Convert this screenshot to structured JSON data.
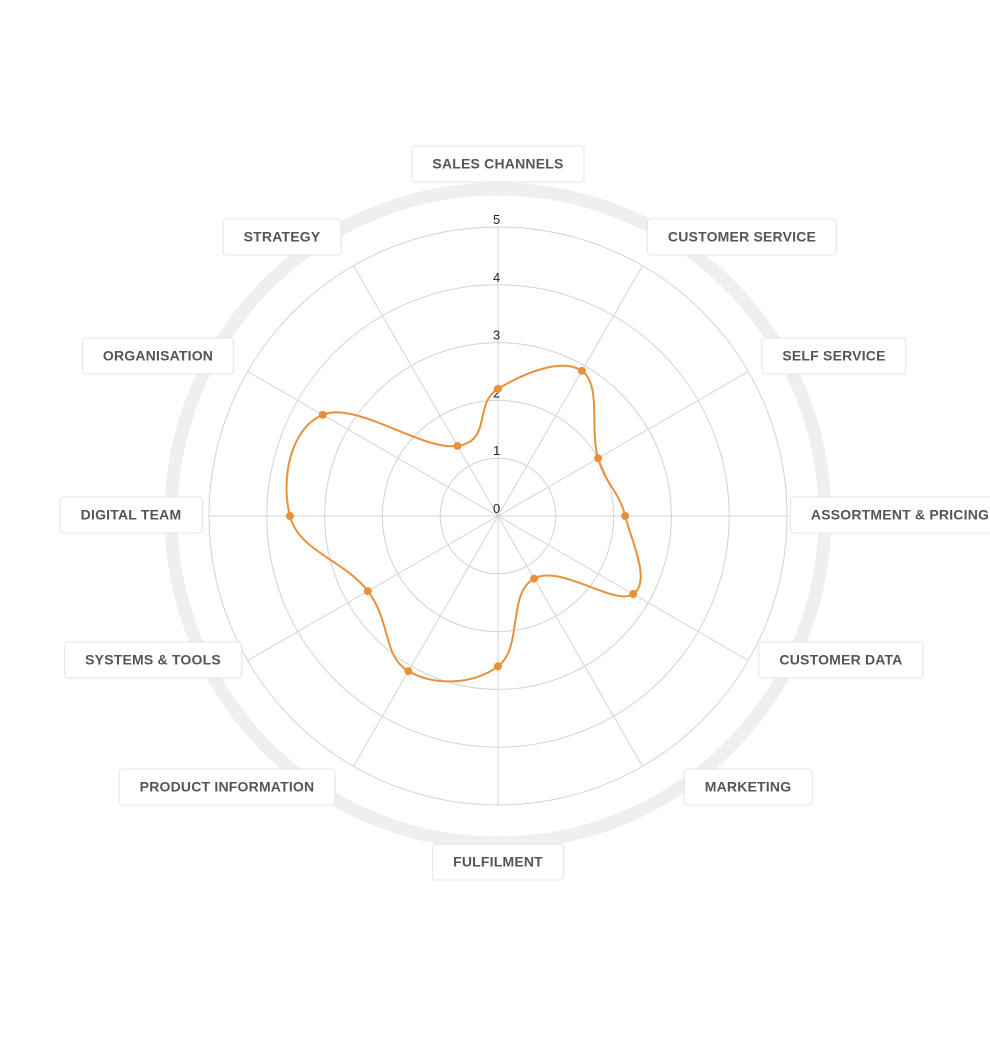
{
  "chart_data": {
    "type": "radar",
    "categories": [
      "SALES CHANNELS",
      "CUSTOMER SERVICE",
      "SELF SERVICE",
      "ASSORTMENT & PRICING",
      "CUSTOMER DATA",
      "MARKETING",
      "FULFILMENT",
      "PRODUCT INFORMATION",
      "SYSTEMS & TOOLS",
      "DIGITAL TEAM",
      "ORGANISATION",
      "STRATEGY"
    ],
    "values": [
      2.2,
      2.9,
      2.0,
      2.2,
      2.7,
      1.25,
      2.6,
      3.1,
      2.6,
      3.6,
      3.5,
      1.4
    ],
    "rlim": [
      0,
      5
    ],
    "ticks": [
      "0",
      "1",
      "2",
      "3",
      "4",
      "5"
    ],
    "grid": true,
    "line_smoothing": "curved",
    "colors": {
      "series": "#e8913a",
      "grid": "#d3d3d3",
      "outer_ring": "#efefef",
      "label_text": "#555555"
    }
  }
}
